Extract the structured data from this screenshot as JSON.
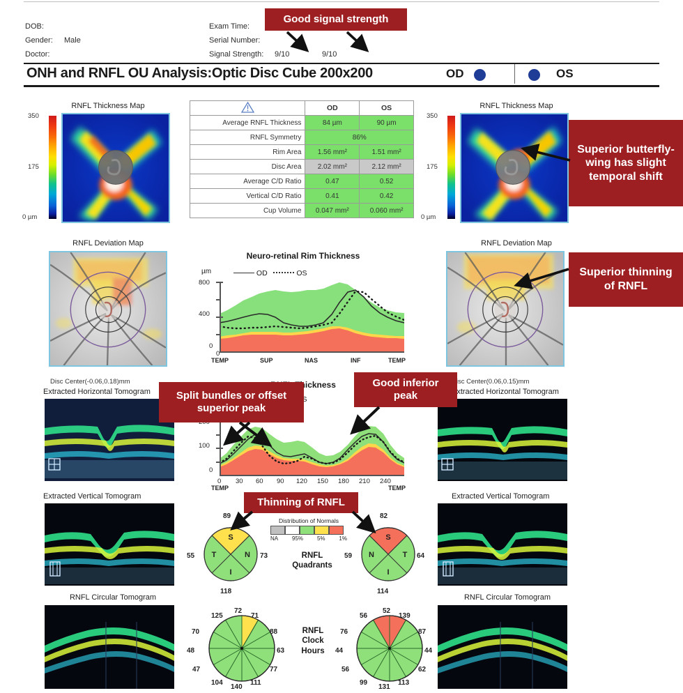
{
  "header": {
    "left_fields": [
      {
        "label": "DOB:",
        "value": ""
      },
      {
        "label": "Gender:",
        "value": "Male"
      },
      {
        "label": "Doctor:",
        "value": ""
      }
    ],
    "right_fields": [
      {
        "label": "Exam Time:",
        "od": "",
        "os": ""
      },
      {
        "label": "Serial Number:",
        "od": "",
        "os": ""
      },
      {
        "label": "Signal Strength:",
        "od": "9/10",
        "os": "9/10"
      }
    ]
  },
  "title": "ONH and RNFL OU Analysis:Optic Disc Cube 200x200",
  "eye_tags": {
    "od": "OD",
    "os": "OS",
    "dot_color": "#1f3d96"
  },
  "panels": {
    "thickness_map_title": "RNFL Thickness Map",
    "deviation_map_title": "RNFL Deviation Map",
    "horizontal_tomogram_title": "Extracted Horizontal Tomogram",
    "vertical_tomogram_title": "Extracted Vertical Tomogram",
    "circular_tomogram_title": "RNFL Circular Tomogram",
    "colorbar": {
      "max": "350",
      "mid": "175",
      "min": "0 µm"
    },
    "disc_center_od": "Disc Center(-0.06,0.18)mm",
    "disc_center_os": "Disc Center(0.06,0.15)mm"
  },
  "metrics_table": {
    "warning_icon": "warning-triangle-icon",
    "columns": [
      "OD",
      "OS"
    ],
    "rows": [
      {
        "label": "Average RNFL Thickness",
        "od": "84 µm",
        "os": "90 µm",
        "od_class": "green",
        "os_class": "green"
      },
      {
        "label": "RNFL Symmetry",
        "span": "86%",
        "span_class": "green"
      },
      {
        "label": "Rim Area",
        "od": "1.56 mm²",
        "os": "1.51 mm²",
        "od_class": "green",
        "os_class": "green"
      },
      {
        "label": "Disc Area",
        "od": "2.02 mm²",
        "os": "2.12 mm²",
        "od_class": "gray",
        "os_class": "gray"
      },
      {
        "label": "Average C/D Ratio",
        "od": "0.47",
        "os": "0.52",
        "od_class": "green",
        "os_class": "green"
      },
      {
        "label": "Vertical C/D Ratio",
        "od": "0.41",
        "os": "0.42",
        "od_class": "green",
        "os_class": "green"
      },
      {
        "label": "Cup Volume",
        "od": "0.047 mm²",
        "os": "0.060 mm²",
        "od_class": "green",
        "os_class": "green"
      }
    ]
  },
  "distribution_legend": {
    "caption": "Distribution of Normals",
    "na": "NA",
    "pct_95": "95%",
    "pct_5": "5%",
    "pct_1": "1%",
    "colors": [
      "#c0c0c0",
      "#ffffff",
      "#7ae06a",
      "#ffe14d",
      "#f4705a"
    ]
  },
  "quadrants": {
    "center_label": "RNFL\nQuadrants",
    "od": {
      "S": "89",
      "T": "55",
      "N": "73",
      "I": "118",
      "s_color": "#ffe14d",
      "t_color": "#8fe07b",
      "n_color": "#8fe07b",
      "i_color": "#8fe07b",
      "letters": {
        "sup": "S",
        "nas": "N",
        "inf": "I",
        "temp": "T"
      }
    },
    "os": {
      "S": "82",
      "T": "64",
      "N": "59",
      "I": "114",
      "s_color": "#f4705a",
      "t_color": "#8fe07b",
      "n_color": "#8fe07b",
      "i_color": "#8fe07b",
      "letters": {
        "sup": "S",
        "nas": "N",
        "inf": "I",
        "temp": "T"
      }
    }
  },
  "clock_hours": {
    "center_label": "RNFL\nClock\nHours",
    "od": {
      "values": [
        "71",
        "88",
        "63",
        "77",
        "111",
        "140",
        "104",
        "47",
        "48",
        "70",
        "125",
        "72"
      ],
      "colors": [
        "#8fe07b",
        "#8fe07b",
        "#8fe07b",
        "#8fe07b",
        "#8fe07b",
        "#8fe07b",
        "#8fe07b",
        "#8fe07b",
        "#8fe07b",
        "#8fe07b",
        "#8fe07b",
        "#ffe14d"
      ]
    },
    "os": {
      "values": [
        "139",
        "87",
        "44",
        "62",
        "113",
        "131",
        "99",
        "56",
        "44",
        "76",
        "56",
        "52"
      ],
      "colors": [
        "#8fe07b",
        "#8fe07b",
        "#8fe07b",
        "#8fe07b",
        "#8fe07b",
        "#8fe07b",
        "#8fe07b",
        "#8fe07b",
        "#8fe07b",
        "#8fe07b",
        "#f4705a",
        "#f4705a"
      ]
    }
  },
  "chart_data": [
    {
      "type": "area",
      "title": "Neuro-retinal Rim Thickness",
      "ylabel": "µm",
      "xlabel": "",
      "ylim": [
        0,
        800
      ],
      "yticks": [
        "800",
        "400",
        "0"
      ],
      "xticks": [
        "0"
      ],
      "categories": [
        "TEMP",
        "SUP",
        "NAS",
        "INF",
        "TEMP"
      ],
      "legend": [
        "OD",
        "OS"
      ],
      "legend_position": "top-left",
      "grid": false,
      "bands": {
        "normal_green_upper": [
          430,
          470,
          530,
          580,
          620,
          660,
          690,
          700,
          690,
          680,
          690,
          700,
          700,
          720,
          760,
          790,
          770,
          700,
          620,
          560,
          500,
          470,
          450,
          440
        ],
        "yellow_upper": [
          170,
          180,
          195,
          210,
          220,
          225,
          225,
          220,
          215,
          215,
          220,
          230,
          245,
          265,
          285,
          290,
          270,
          240,
          215,
          200,
          190,
          185,
          180,
          175
        ],
        "red_upper": [
          140,
          150,
          165,
          180,
          190,
          195,
          195,
          190,
          185,
          185,
          190,
          200,
          215,
          235,
          255,
          260,
          240,
          210,
          185,
          170,
          160,
          155,
          150,
          145
        ]
      },
      "series": [
        {
          "name": "OD",
          "style": "solid",
          "values": [
            330,
            345,
            370,
            395,
            415,
            430,
            425,
            390,
            330,
            300,
            290,
            290,
            300,
            330,
            420,
            560,
            680,
            700,
            620,
            520,
            440,
            390,
            350,
            330
          ]
        },
        {
          "name": "OS",
          "style": "dotted",
          "values": [
            290,
            275,
            265,
            265,
            270,
            275,
            280,
            285,
            280,
            270,
            265,
            270,
            290,
            300,
            330,
            430,
            570,
            690,
            680,
            600,
            520,
            450,
            400,
            355
          ]
        }
      ]
    },
    {
      "type": "area",
      "title": "RNFL Thickness",
      "ylabel": "µm",
      "ylim": [
        0,
        200
      ],
      "yticks": [
        "200",
        "100",
        "0"
      ],
      "xticks": [
        "0",
        "30",
        "60",
        "90",
        "120",
        "150",
        "180",
        "210",
        "240"
      ],
      "categories": [
        "TEMP",
        "TEMP"
      ],
      "legend": [
        "OD",
        "OS"
      ],
      "grid": false,
      "bands": {
        "normal_green_upper": [
          60,
          80,
          110,
          140,
          165,
          175,
          170,
          150,
          130,
          118,
          120,
          125,
          120,
          100,
          80,
          68,
          70,
          85,
          110,
          140,
          165,
          180,
          178,
          150,
          110,
          80,
          62
        ],
        "yellow_upper": [
          33,
          45,
          62,
          82,
          100,
          108,
          104,
          88,
          72,
          62,
          60,
          60,
          56,
          46,
          38,
          33,
          35,
          44,
          60,
          82,
          102,
          114,
          112,
          92,
          64,
          44,
          34
        ],
        "red_upper": [
          28,
          38,
          54,
          72,
          88,
          95,
          92,
          77,
          62,
          53,
          51,
          51,
          48,
          39,
          32,
          28,
          30,
          38,
          52,
          72,
          90,
          101,
          99,
          81,
          55,
          37,
          29
        ]
      },
      "series": [
        {
          "name": "OD",
          "style": "solid",
          "values": [
            40,
            55,
            78,
            105,
            130,
            148,
            140,
            110,
            82,
            68,
            66,
            72,
            78,
            62,
            46,
            40,
            45,
            62,
            92,
            120,
            142,
            152,
            148,
            120,
            82,
            55,
            42
          ]
        },
        {
          "name": "OS",
          "style": "dotted",
          "values": [
            42,
            60,
            88,
            118,
            140,
            135,
            108,
            72,
            48,
            40,
            42,
            52,
            68,
            60,
            46,
            40,
            44,
            58,
            82,
            108,
            128,
            138,
            140,
            118,
            84,
            58,
            44
          ]
        }
      ]
    }
  ],
  "annotations": [
    {
      "id": "good-signal-strength",
      "text": "Good signal strength"
    },
    {
      "id": "superior-butterfly-wing",
      "text": "Superior butterfly-wing has slight temporal shift"
    },
    {
      "id": "superior-thinning",
      "text": "Superior thinning of RNFL"
    },
    {
      "id": "split-bundles",
      "text": "Split bundles or offset superior peak"
    },
    {
      "id": "good-inferior-peak",
      "text": "Good inferior peak"
    },
    {
      "id": "thinning-of-rnfl",
      "text": "Thinning of RNFL"
    }
  ],
  "colors": {
    "callout_bg": "#9e1f22",
    "green": "#8fe07b",
    "yellow": "#ffe14d",
    "red": "#f4705a",
    "gray": "#c0c0c0",
    "panel_border": "#7ec6e0"
  }
}
